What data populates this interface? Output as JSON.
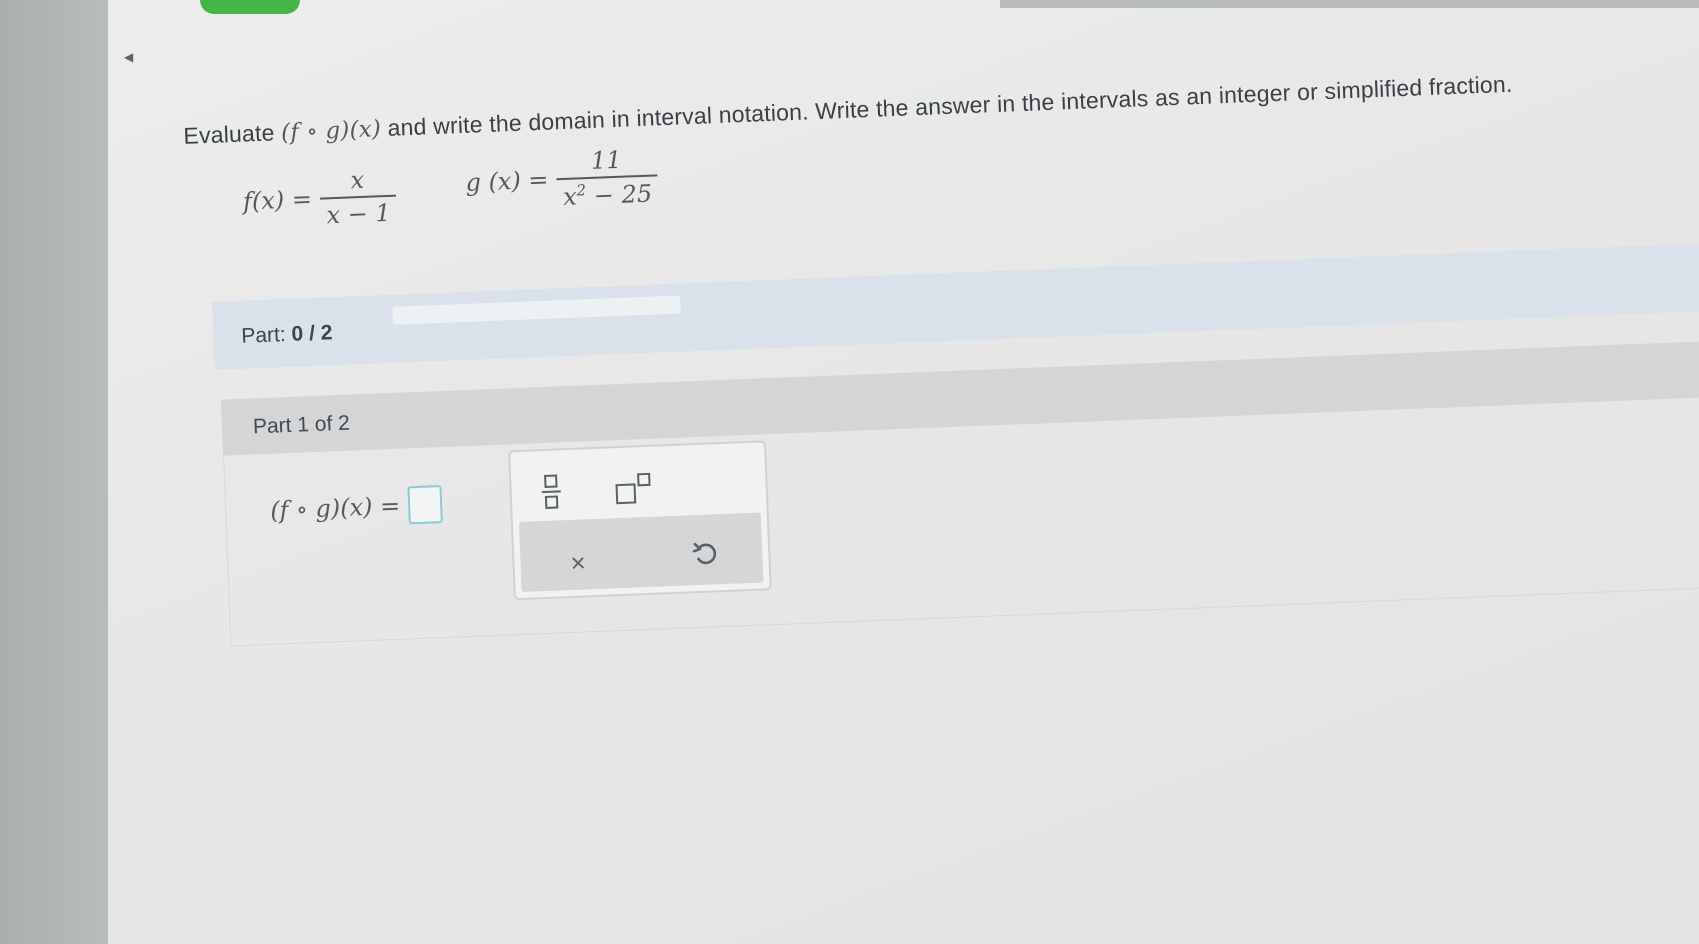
{
  "problem": {
    "instructions_prefix": "Evaluate",
    "compose_expr": "(f ∘ g)(x)",
    "instructions_suffix": "and write the domain in interval notation. Write the answer in the intervals as an integer or simplified fraction."
  },
  "functions": {
    "f": {
      "lhs": "f(x) =",
      "numerator": "x",
      "denominator": "x − 1"
    },
    "g": {
      "lhs": "g (x) =",
      "numerator": "11",
      "denominator_base": "x",
      "denominator_exp": "2",
      "denominator_rest": " − 25"
    }
  },
  "progress": {
    "label": "Part:",
    "current": "0",
    "separator": "/",
    "total": "2",
    "fraction": 0
  },
  "part": {
    "header": "Part 1 of 2",
    "answer_lhs": "(f ∘ g)(x) =",
    "answer_value": ""
  },
  "keypad": {
    "keys": [
      "fraction-icon",
      "superscript-icon",
      "clear-icon",
      "undo-icon"
    ],
    "clear_symbol": "×"
  },
  "colors": {
    "top_button": "#43b549",
    "part_bar": "#d9e1ea",
    "answer_box_border": "#8fc8d8"
  }
}
